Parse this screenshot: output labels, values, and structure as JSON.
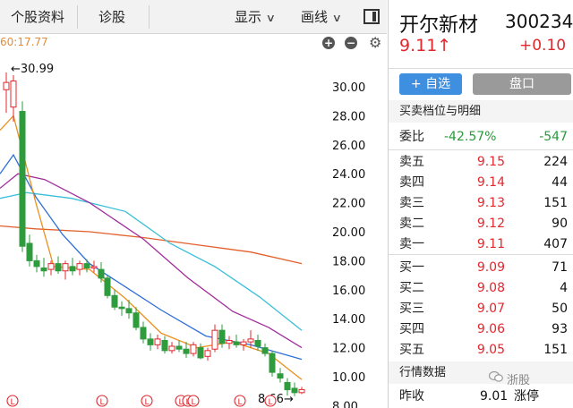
{
  "tabs": {
    "stock_info": "个股资料",
    "diagnose": "诊股",
    "display": "显示",
    "draw": "画线"
  },
  "header": {
    "time_label": "60:17.77"
  },
  "quote": {
    "name": "开尔新材",
    "code": "300234",
    "price": "9.11↑",
    "change": "+0.10"
  },
  "buttons": {
    "add_watch": "+ 自选",
    "pankou": "盘口"
  },
  "order_book": {
    "section_title": "买卖档位与明细",
    "weibi_label": "委比",
    "weibi_pct": "-42.57%",
    "weibi_val": "-547",
    "sells": [
      {
        "label": "卖五",
        "price": "9.15",
        "vol": "224"
      },
      {
        "label": "卖四",
        "price": "9.14",
        "vol": "44"
      },
      {
        "label": "卖三",
        "price": "9.13",
        "vol": "151"
      },
      {
        "label": "卖二",
        "price": "9.12",
        "vol": "90"
      },
      {
        "label": "卖一",
        "price": "9.11",
        "vol": "407"
      }
    ],
    "buys": [
      {
        "label": "买一",
        "price": "9.09",
        "vol": "71"
      },
      {
        "label": "买二",
        "price": "9.08",
        "vol": "4"
      },
      {
        "label": "买三",
        "price": "9.07",
        "vol": "50"
      },
      {
        "label": "买四",
        "price": "9.06",
        "vol": "93"
      },
      {
        "label": "买五",
        "price": "9.05",
        "vol": "151"
      }
    ]
  },
  "market": {
    "section_title": "行情数据",
    "prev_close_label": "昨收",
    "prev_close": "9.01",
    "limit_label": "涨停"
  },
  "watermark": "浙股",
  "chart": {
    "y_labels": [
      "30.00",
      "28.00",
      "26.00",
      "24.00",
      "22.00",
      "20.00",
      "18.00",
      "16.00",
      "14.00",
      "12.00",
      "10.00",
      "8.00"
    ],
    "high_label": "←30.99",
    "low_label": "8.66→",
    "marker_letter": "L",
    "colors": {
      "up": "#e0282e",
      "down": "#2e9b3c",
      "ma5": "#e9901e",
      "ma10": "#2f6fd8",
      "ma20": "#a22c9a",
      "ma30": "#39bfd9",
      "ma60": "#e25f2a"
    }
  }
}
